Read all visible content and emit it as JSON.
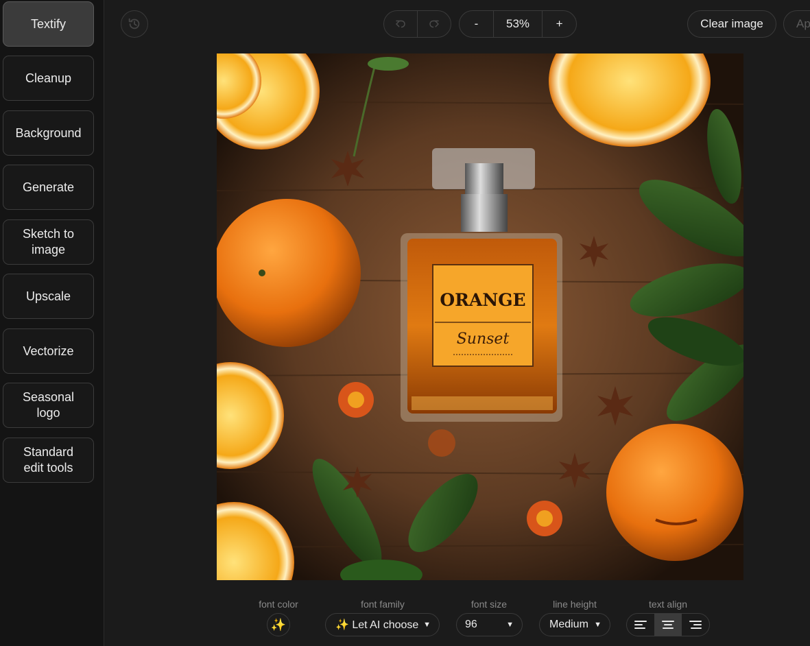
{
  "sidebar": {
    "items": [
      {
        "label": "Textify",
        "active": true
      },
      {
        "label": "Cleanup"
      },
      {
        "label": "Background"
      },
      {
        "label": "Generate"
      },
      {
        "label": "Sketch to image"
      },
      {
        "label": "Upscale"
      },
      {
        "label": "Vectorize"
      },
      {
        "label": "Seasonal logo"
      },
      {
        "label": "Standard edit tools"
      }
    ]
  },
  "toolbar": {
    "history_icon": "history-icon",
    "undo_icon": "undo-icon",
    "redo_icon": "redo-icon",
    "zoom_out_label": "-",
    "zoom_value": "53%",
    "zoom_in_label": "+",
    "clear_label": "Clear image",
    "apply_label": "Ap"
  },
  "canvas": {
    "image_label_title": "ORANGE",
    "image_label_subtitle": "Sunset"
  },
  "text_controls": {
    "font_color": {
      "label": "font color",
      "icon": "sparkle-icon"
    },
    "font_family": {
      "label": "font family",
      "value": "✨ Let AI choose"
    },
    "font_size": {
      "label": "font size",
      "value": "96"
    },
    "line_height": {
      "label": "line height",
      "value": "Medium"
    },
    "text_align": {
      "label": "text align",
      "selected": "center"
    }
  },
  "colors": {
    "background": "#1b1b1b",
    "sidebar": "#141414",
    "active": "#3b3b3b",
    "border": "#3a3a3a"
  }
}
